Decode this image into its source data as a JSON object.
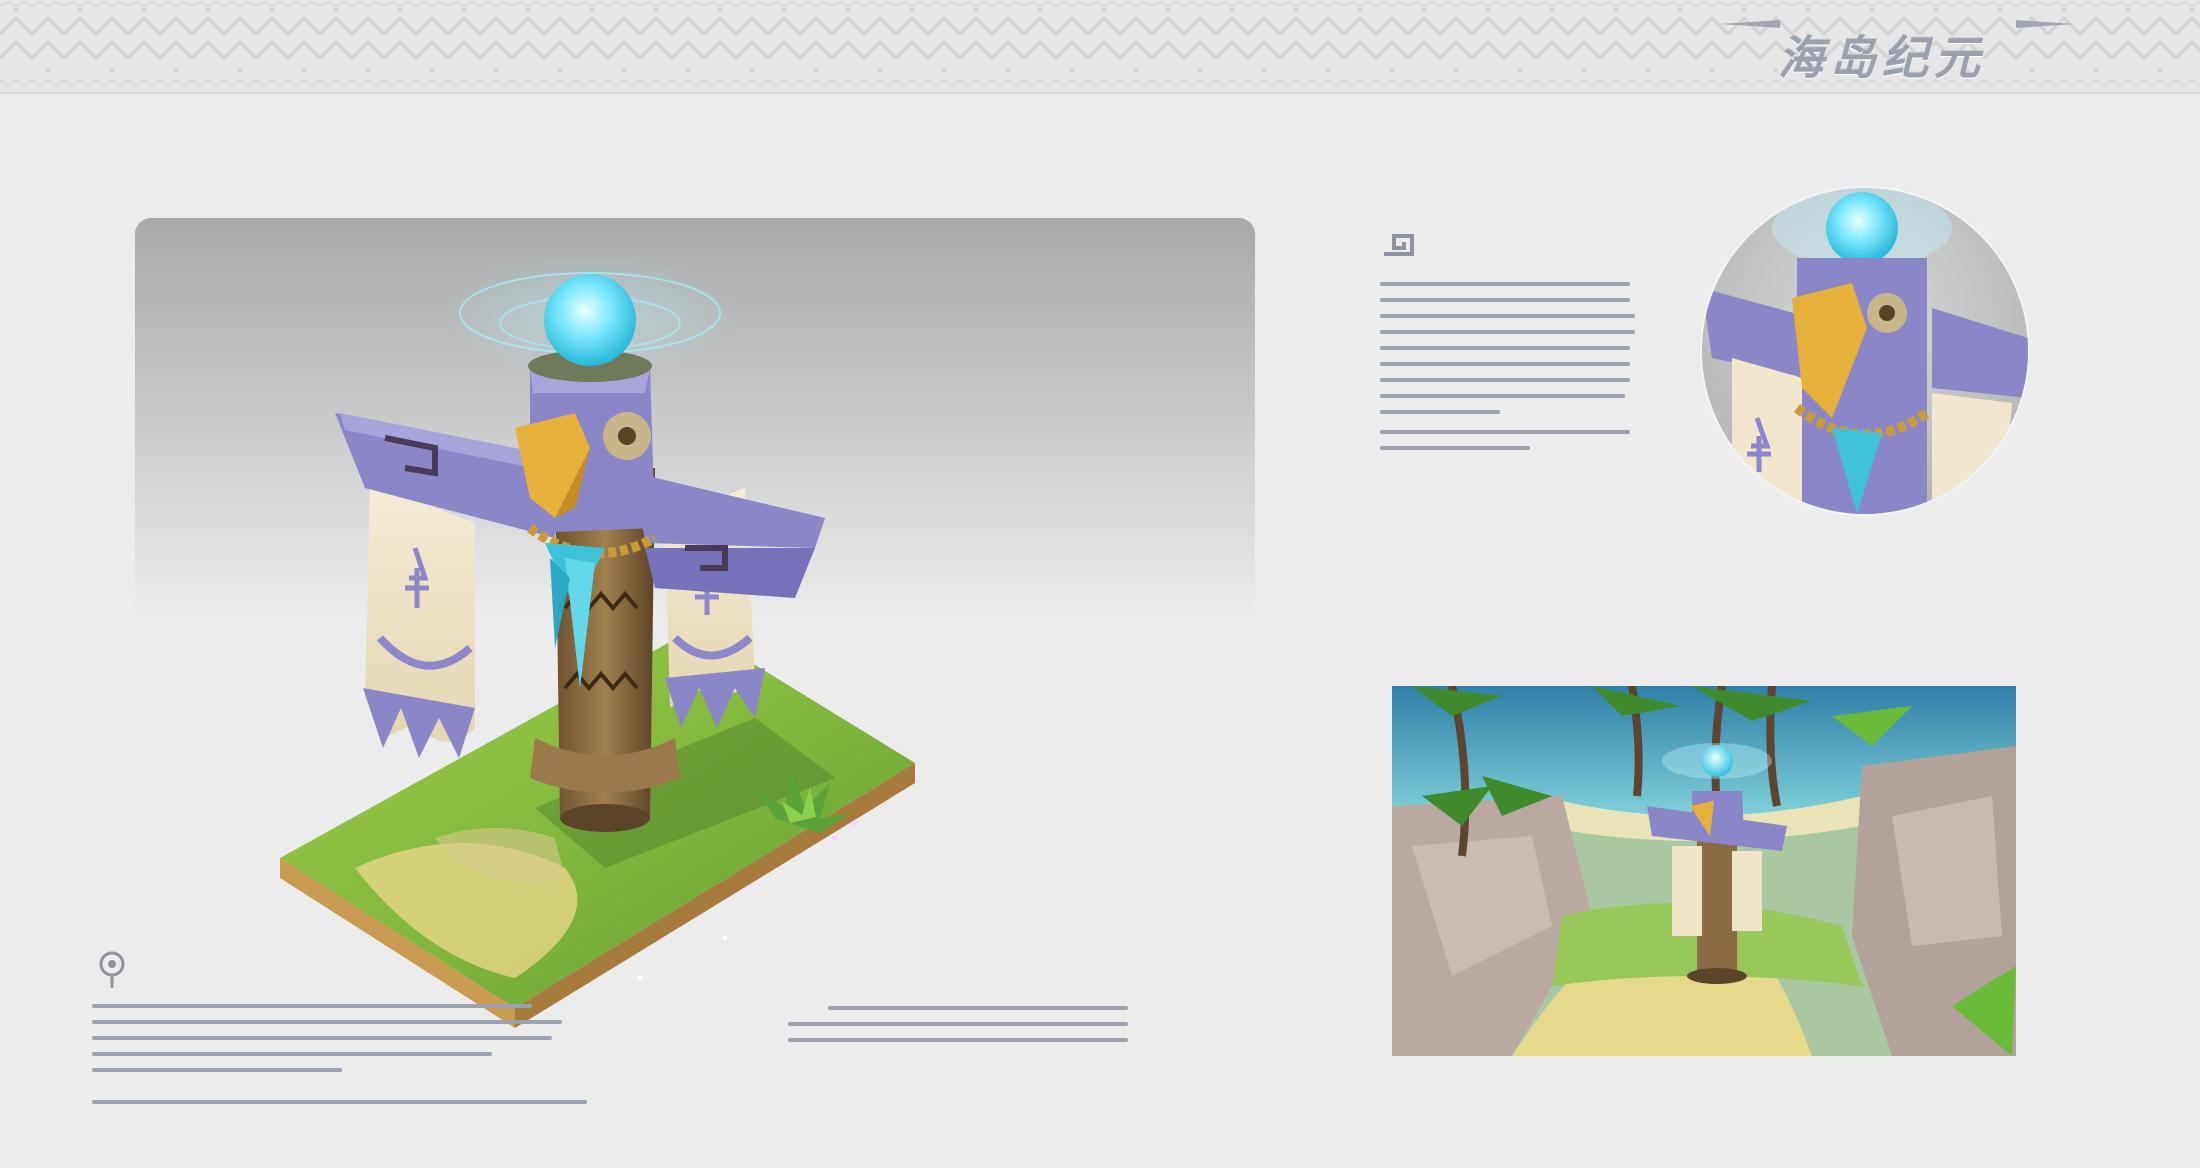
{
  "header": {
    "logo_text": "海岛纪元"
  },
  "colors": {
    "background": "#ececec",
    "band": "#e6e6e6",
    "totem_purple": "#8a86c8",
    "orb_cyan": "#6fe8ff",
    "grass": "#7fb33e",
    "wood": "#8b6a3f",
    "beak": "#e6b13a"
  },
  "icons": {
    "header_ornament": "zigzag-border-icon",
    "section_one_glyph": "spiral-glyph-icon",
    "section_two_glyph": "key-glyph-icon"
  },
  "scenes": {
    "main": "totem-on-grass-tile",
    "detail": "totem-closeup-circle",
    "environment": "totem-in-jungle-scene"
  }
}
